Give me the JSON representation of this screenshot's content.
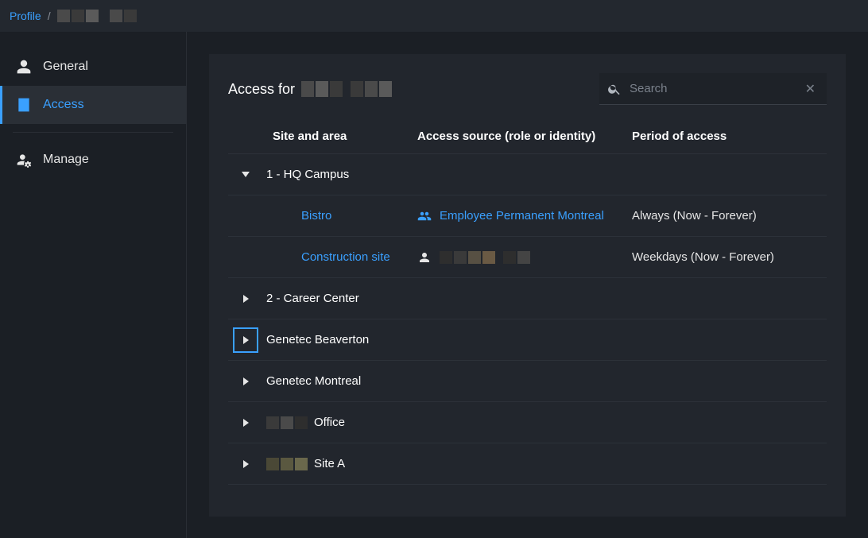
{
  "breadcrumb": {
    "root": "Profile",
    "sep": "/"
  },
  "sidebar": {
    "items": [
      {
        "label": "General"
      },
      {
        "label": "Access"
      },
      {
        "label": "Manage"
      }
    ]
  },
  "panel": {
    "title_prefix": "Access for"
  },
  "search": {
    "placeholder": "Search"
  },
  "columns": {
    "site": "Site and area",
    "source": "Access source (role or identity)",
    "period": "Period of access"
  },
  "rows": {
    "hq": {
      "name": "1 - HQ Campus"
    },
    "bistro": {
      "name": "Bistro",
      "source": "Employee Permanent Montreal",
      "period": "Always  (Now - Forever)"
    },
    "construction": {
      "name": "Construction site",
      "period": "Weekdays  (Now - Forever)"
    },
    "career": {
      "name": "2 - Career Center"
    },
    "beaverton": {
      "name": "Genetec Beaverton"
    },
    "montreal": {
      "name": "Genetec Montreal"
    },
    "office": {
      "name": "Office"
    },
    "siteA": {
      "name": "Site A"
    }
  }
}
